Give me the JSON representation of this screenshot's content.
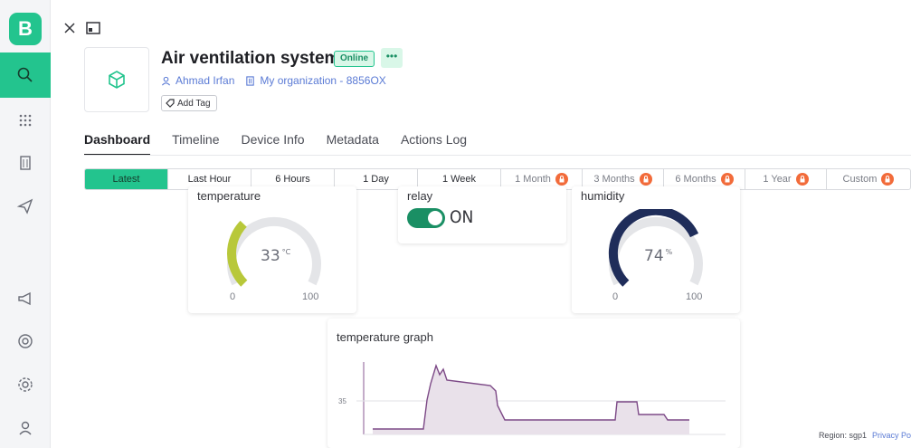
{
  "app": {
    "logo_letter": "B"
  },
  "device": {
    "name": "Air ventilation system",
    "status": "Online",
    "owner": "Ahmad Irfan",
    "organization": "My organization - 8856OX",
    "add_tag": "Add Tag"
  },
  "tabs": [
    {
      "label": "Dashboard",
      "active": true
    },
    {
      "label": "Timeline"
    },
    {
      "label": "Device Info"
    },
    {
      "label": "Metadata"
    },
    {
      "label": "Actions Log"
    }
  ],
  "time_ranges": [
    {
      "label": "Latest",
      "active": true
    },
    {
      "label": "Last Hour"
    },
    {
      "label": "6 Hours"
    },
    {
      "label": "1 Day"
    },
    {
      "label": "1 Week"
    },
    {
      "label": "1 Month",
      "locked": true
    },
    {
      "label": "3 Months",
      "locked": true
    },
    {
      "label": "6 Months",
      "locked": true
    },
    {
      "label": "1 Year",
      "locked": true
    },
    {
      "label": "Custom",
      "locked": true
    }
  ],
  "widgets": {
    "temperature": {
      "title": "temperature",
      "value": "33",
      "unit": "°C",
      "min": "0",
      "max": "100",
      "color": "#b8c83a",
      "level": 0.33
    },
    "relay": {
      "title": "relay",
      "state": "ON"
    },
    "humidity": {
      "title": "humidity",
      "value": "74",
      "unit": "%",
      "min": "0",
      "max": "100",
      "color": "#1f2d5a",
      "level": 0.74
    },
    "graph": {
      "title": "temperature graph",
      "y_tick": "35"
    }
  },
  "footer": {
    "region": "Region: sgp1",
    "privacy": "Privacy Po"
  },
  "colors": {
    "brand": "#23c48e",
    "lock": "#f26b3a",
    "link": "#5b7bd5"
  }
}
